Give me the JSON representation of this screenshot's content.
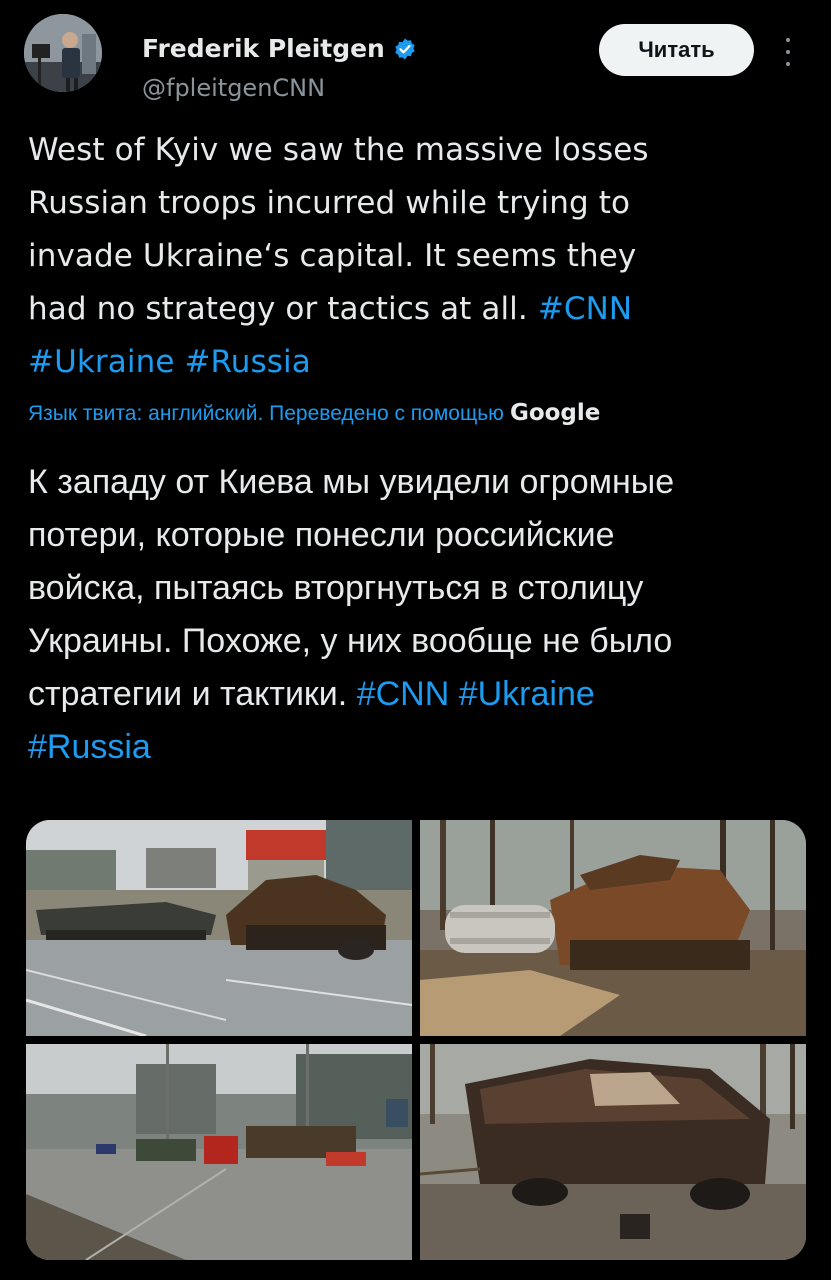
{
  "author": {
    "name": "Frederik Pleitgen",
    "handle": "@fpleitgenCNN",
    "verified": true,
    "verified_color": "#1d9bf0"
  },
  "actions": {
    "follow_label": "Читать",
    "more_icon": "more-vertical-icon"
  },
  "tweet": {
    "lines": [
      {
        "text": "West of Kyiv we saw the massive losses"
      },
      {
        "text": "Russian troops incurred while trying to"
      },
      {
        "text": "invade Ukraine‘s capital. It seems they"
      },
      {
        "text": "had no strategy or tactics at all. ",
        "tag": "#CNN"
      },
      {
        "text": "",
        "tag": "#Ukraine #Russia"
      }
    ]
  },
  "translation": {
    "note": "Язык твита: английский. Переведено с помощью",
    "provider": "Google",
    "lines": [
      {
        "text": "К западу от Киева мы увидели огромные"
      },
      {
        "text": "потери, которые понесли российские"
      },
      {
        "text": "войска, пытаясь вторгнуться в столицу"
      },
      {
        "text": "Украины. Похоже, у них вообще не было"
      },
      {
        "text": "стратегии и тактики. ",
        "tag": "#CNN #Ukraine"
      },
      {
        "text": "",
        "tag": "#Russia"
      }
    ]
  },
  "media": [
    {
      "name": "photo-road-destroyed-tanks"
    },
    {
      "name": "photo-forest-burnt-tank"
    },
    {
      "name": "photo-highway-wrecked-vehicles"
    },
    {
      "name": "photo-burnt-armored-car"
    }
  ],
  "colors": {
    "background": "#000000",
    "text": "#e7e9ea",
    "secondary": "#8b949a",
    "link": "#1d9bf0",
    "button_bg": "#eff3f4"
  }
}
